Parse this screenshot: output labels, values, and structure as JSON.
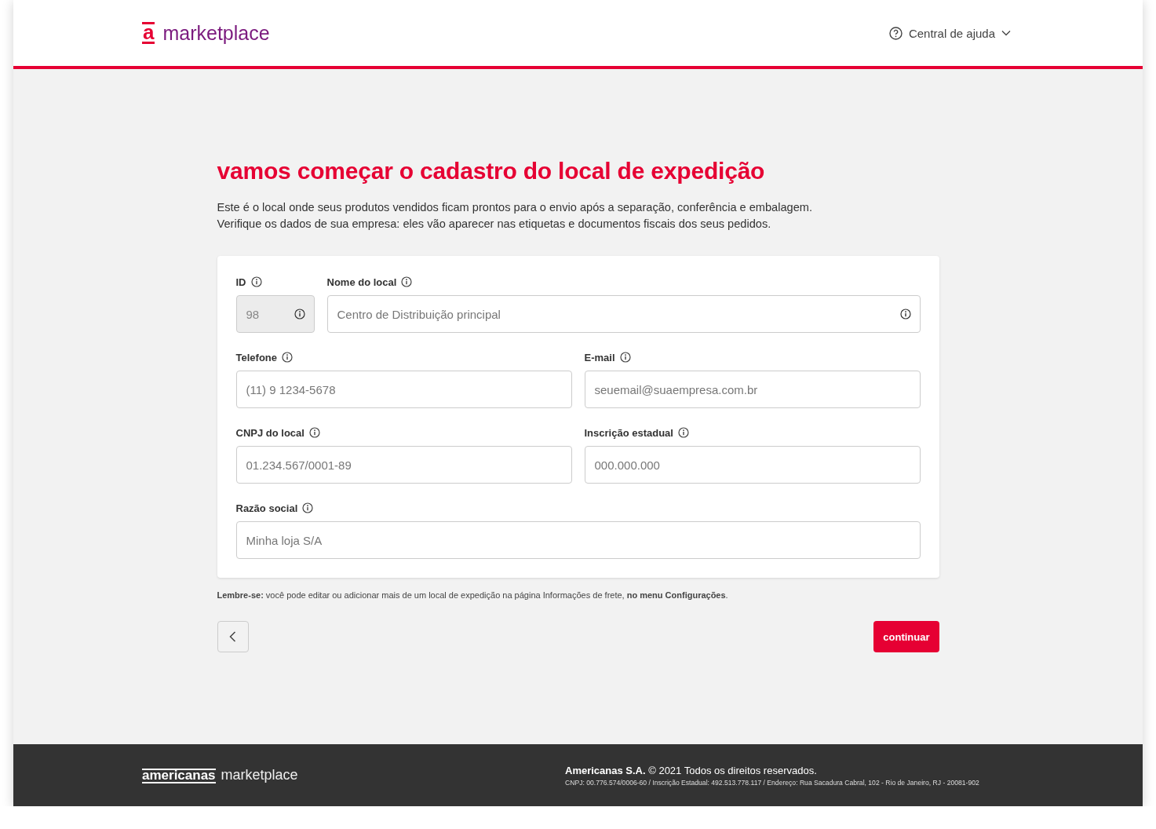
{
  "header": {
    "logo": {
      "mark": "a",
      "text": "marketplace"
    },
    "help_menu": {
      "label": "Central de ajuda",
      "expanded": false
    }
  },
  "title": "vamos começar o cadastro do local de expedição",
  "intro": [
    "Este é o local onde seus produtos vendidos ficam prontos para o envio após a separação, conferência e embalagem.",
    "Verifique os dados de sua empresa: eles vão aparecer nas etiquetas e documentos fiscais dos seus pedidos."
  ],
  "form": {
    "rows": [
      [
        {
          "label": "ID",
          "value": "98",
          "disabled": true,
          "info_button": true
        },
        {
          "label": "Nome do local",
          "placeholder": "Centro de Distribuição principal",
          "disabled": false,
          "info_button": true
        }
      ],
      [
        {
          "label": "Telefone",
          "placeholder": "(11) 9 1234-5678",
          "disabled": false,
          "info_button": false
        },
        {
          "label": "E-mail",
          "placeholder": "seuemail@suaempresa.com.br",
          "disabled": false,
          "info_button": false
        }
      ],
      [
        {
          "label": "CNPJ do local",
          "placeholder": "01.234.567/0001-89",
          "disabled": false,
          "info_button": false
        },
        {
          "label": "Inscrição estadual",
          "placeholder": "000.000.000",
          "disabled": false,
          "info_button": false
        }
      ],
      [
        {
          "label": "Razão social",
          "placeholder": "Minha loja S/A",
          "disabled": false,
          "info_button": false
        }
      ]
    ]
  },
  "note": "**Lembre-se:** você pode editar ou adicionar mais de um local de expedição na página Informações de frete, **no menu Configurações**.",
  "actions": {
    "continue_label": "continuar"
  },
  "footer": {
    "logo": {
      "brand": "americanas",
      "text": "marketplace"
    },
    "copyright": "**Americanas S.A.** © 2021 Todos os direitos reservados.",
    "legal": "CNPJ: 00.776.574/0006-60 / Inscrição Estadual: 492.513.778.117 / Endereço: Rua Sacadura Cabral, 102 - Rio de Janeiro, RJ - 20081-902"
  }
}
